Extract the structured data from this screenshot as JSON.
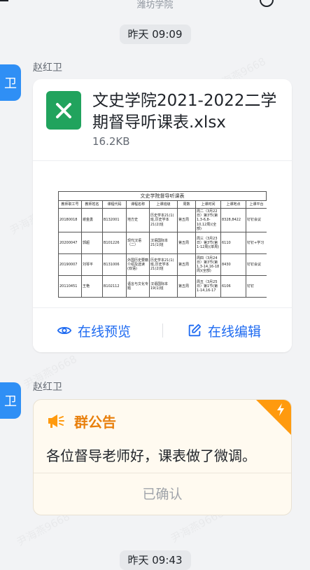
{
  "header": {
    "subtitle": "潍坊学院"
  },
  "timestamps": {
    "first": "昨天 09:09",
    "second": "昨天 09:43"
  },
  "messages": [
    {
      "sender": "赵红卫",
      "avatar_text": "卫",
      "file": {
        "name": "文史学院2021-2022二学期督导听课表.xlsx",
        "size": "16.2KB",
        "icon": "excel-file-icon",
        "preview": {
          "title": "文史学院督导听课表",
          "headers": [
            "教师职工号",
            "教师姓名",
            "课程代码",
            "课程名称",
            "上课班级",
            "周数",
            "上课时间",
            "上课地点",
            "上课平台"
          ],
          "rows": [
            [
              "20180018",
              "谢金勇",
              "B132001",
              "地方史",
              "历史学本21(1)班,历史学本21(2)班",
              "第五周",
              "周二（3月22日）第3节(第1,3-6,8-10,12周)(全部)",
              "8328,8422",
              "钉钉会议"
            ],
            [
              "20200047",
              "郭超",
              "B101226",
              "现代汉语（二）",
              "汉语国际本21(1)班",
              "第五周",
              "周三（3月23日）第3节(第1-12周)(单周)",
              "6110",
              "钉钉+学习"
            ],
            [
              "20190007",
              "刘琴平",
              "B131006",
              "外国历史要籍介绍及选读(双语)",
              "历史学本21(1)班,历史学本21(2)班",
              "第五周",
              "周四（3月24日）第3节(第1,3-14,16-18周)(全部)",
              "8430",
              "钉钉会议"
            ],
            [
              "20110451",
              "王艳",
              "B102112",
              "语言与文化专题",
              "汉语国际本19(1)班",
              "第五周",
              "周五（3月25日）第1节(第1-14,16-17",
              "6106",
              "钉钉"
            ]
          ]
        },
        "actions": {
          "preview": "在线预览",
          "edit": "在线编辑"
        }
      }
    },
    {
      "sender": "赵红卫",
      "avatar_text": "卫",
      "notice": {
        "title": "群公告",
        "text": "各位督导老师好，课表做了微调。",
        "confirm_label": "已确认"
      }
    }
  ],
  "watermark": "尹海燕9668",
  "colors": {
    "accent": "#1f6bf1",
    "excel": "#21a35d",
    "notice": "#ff9a0e"
  }
}
